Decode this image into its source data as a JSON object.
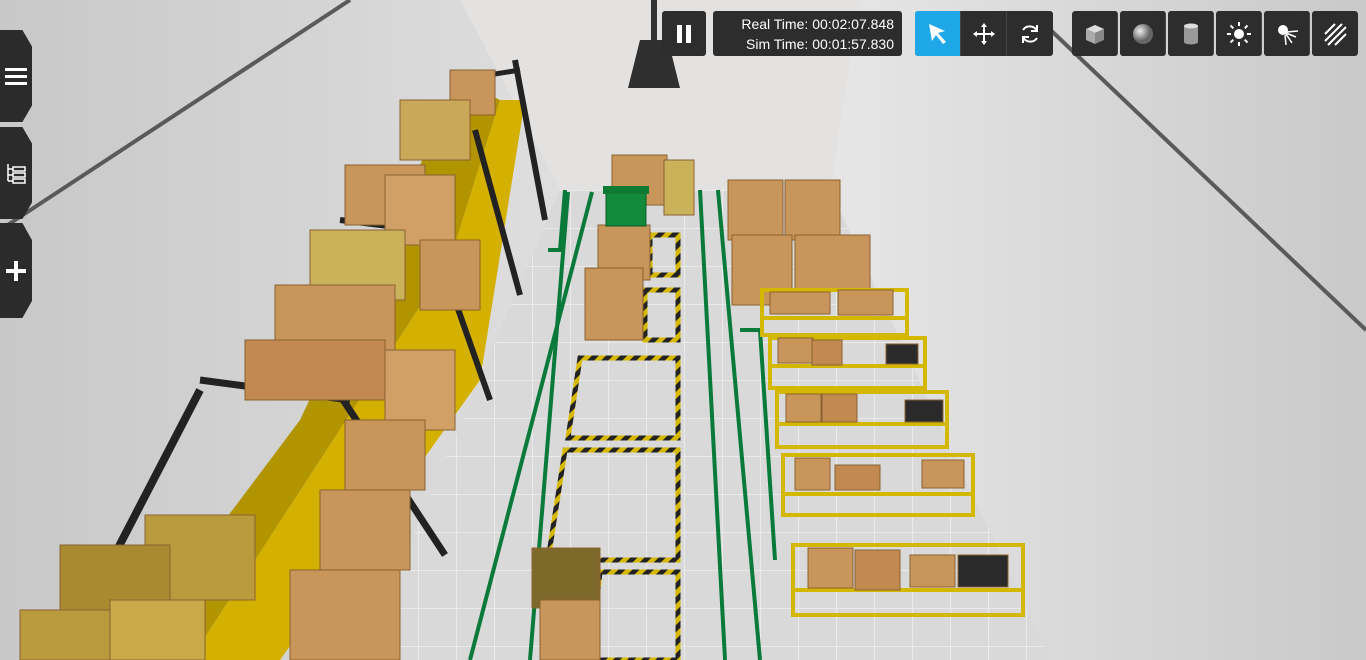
{
  "timing": {
    "real_label": "Real Time:",
    "real_value": "00:02:07.848",
    "sim_label": "Sim Time:",
    "sim_value": "00:01:57.830"
  },
  "sidebar": {
    "items": [
      {
        "icon": "menu-icon"
      },
      {
        "icon": "tree-icon"
      },
      {
        "icon": "plus-icon"
      }
    ]
  },
  "toolbar": {
    "play_state": "pause-icon",
    "modes": [
      {
        "icon": "select-arrow-icon",
        "active": true
      },
      {
        "icon": "translate-icon",
        "active": false
      },
      {
        "icon": "rotate-icon",
        "active": false
      }
    ],
    "insert": [
      {
        "icon": "box-icon"
      },
      {
        "icon": "sphere-icon"
      },
      {
        "icon": "cylinder-icon"
      },
      {
        "icon": "point-light-icon"
      },
      {
        "icon": "spot-light-icon"
      },
      {
        "icon": "directional-light-icon"
      }
    ]
  },
  "colors": {
    "accent": "#1fa8e8",
    "toolbar_bg": "#2d2d2d",
    "shelf_yellow": "#d4b000",
    "floor": "#d8d8d8",
    "lane_green": "#0a7a3a",
    "box_cardboard": "#c8955a"
  }
}
